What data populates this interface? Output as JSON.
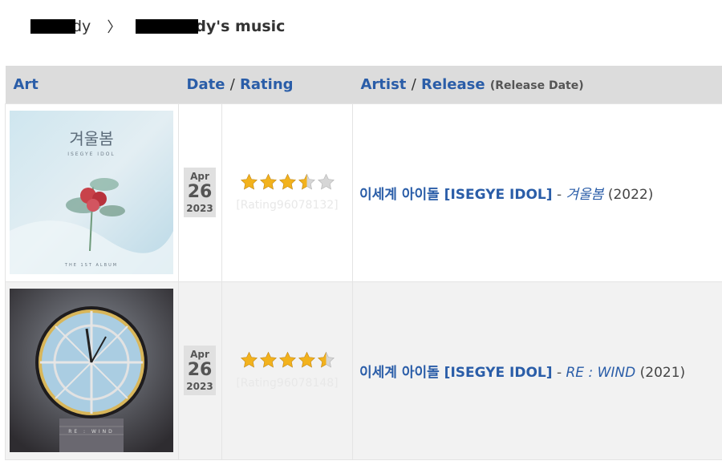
{
  "breadcrumb": {
    "user_tail": "dy",
    "separator": "〉",
    "page_tail": "dy's music"
  },
  "table": {
    "headers": {
      "art": "Art",
      "date": "Date",
      "slash": "/",
      "rating": "Rating",
      "artist": "Artist",
      "release": "Release",
      "release_date": "(Release Date)"
    },
    "rows": [
      {
        "cover_title": "겨울봄",
        "cover_sub": "ISEGYE IDOL",
        "cover_footer": "THE 1ST ALBUM",
        "month": "Apr",
        "day": "26",
        "year": "2023",
        "stars": 3.5,
        "rating_label": "[Rating96078132]",
        "artist": "이세계 아이돌 [ISEGYE IDOL]",
        "dash": "-",
        "album": "겨울봄",
        "release_date": "(2022)"
      },
      {
        "cover_title": "",
        "cover_sub": "",
        "cover_footer": "RE : WIND",
        "month": "Apr",
        "day": "26",
        "year": "2023",
        "stars": 4.5,
        "rating_label": "[Rating96078148]",
        "artist": "이세계 아이돌 [ISEGYE IDOL]",
        "dash": "-",
        "album": "RE : WIND",
        "release_date": "(2021)"
      }
    ]
  },
  "colors": {
    "link": "#2a5da8",
    "star_full": "#f2b21d",
    "star_empty": "#d6d6d6"
  }
}
